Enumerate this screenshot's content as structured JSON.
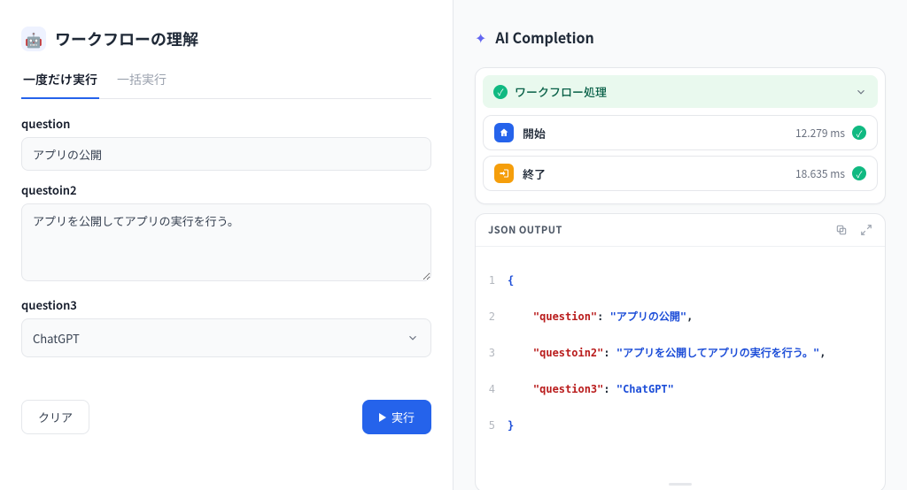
{
  "header": {
    "icon_glyph": "🤖",
    "title": "ワークフローの理解"
  },
  "tabs": {
    "run_once": "一度だけ実行",
    "batch_run": "一括実行",
    "active": 0
  },
  "form": {
    "q1_label": "question",
    "q1_value": "アプリの公開",
    "q2_label": "questoin2",
    "q2_value": "アプリを公開してアプリの実行を行う。",
    "q3_label": "question3",
    "q3_value": "ChatGPT"
  },
  "buttons": {
    "clear": "クリア",
    "run": "実行"
  },
  "completion": {
    "title": "AI Completion",
    "wf_label": "ワークフロー処理",
    "steps": [
      {
        "name": "開始",
        "ms": "12.279 ms",
        "icon": "home",
        "color": "blue"
      },
      {
        "name": "終了",
        "ms": "18.635 ms",
        "icon": "exit",
        "color": "orange"
      }
    ],
    "json_label": "JSON OUTPUT",
    "json": {
      "l1": "{",
      "l2_key": "\"question\"",
      "l2_val": "\"アプリの公開\"",
      "l3_key": "\"questoin2\"",
      "l3_val": "\"アプリを公開してアプリの実行を行う。\"",
      "l4_key": "\"question3\"",
      "l4_val": "\"ChatGPT\"",
      "l5": "}"
    }
  }
}
